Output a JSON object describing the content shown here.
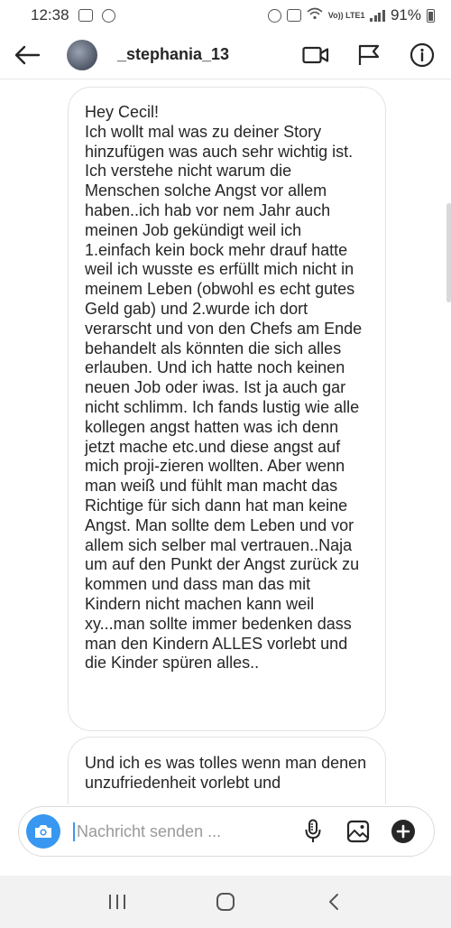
{
  "status_bar": {
    "time": "12:38",
    "network_label": "Vo)) LTE1",
    "battery": "91%"
  },
  "header": {
    "username": "_stephania_13",
    "icons": [
      "back-arrow-icon",
      "video-call-icon",
      "flag-icon",
      "info-icon"
    ]
  },
  "messages": [
    {
      "text": "Hey Cecil!\nIch wollt mal was zu deiner Story hinzufügen was auch sehr wichtig ist. Ich verstehe nicht warum die Menschen solche Angst vor allem haben..ich hab vor nem Jahr auch meinen Job gekündigt weil ich 1.einfach kein bock mehr drauf hatte weil ich wusste es erfüllt mich nicht in meinem Leben (obwohl es echt gutes Geld gab) und 2.wurde ich dort verarscht und von den Chefs am Ende behandelt als könnten die sich alles erlauben. Und ich hatte noch keinen neuen Job oder iwas. Ist ja auch gar nicht schlimm. Ich fands lustig wie alle kollegen angst hatten was ich denn jetzt mache etc.und diese angst auf mich proji-zieren wollten. Aber wenn man weiß und fühlt man macht das Richtige für sich dann hat man keine Angst. Man sollte dem Leben und vor allem sich selber mal vertrauen..Naja um auf den Punkt der Angst zurück zu kommen und dass man das mit Kindern nicht machen kann weil xy...man sollte immer bedenken dass man den Kindern ALLES vorlebt und die Kinder spüren alles.."
    },
    {
      "text": "Und ich es was tolles wenn man denen unzufriedenheit vorlebt und"
    }
  ],
  "composer": {
    "placeholder": "Nachricht senden ...",
    "icons": [
      "camera-icon",
      "microphone-icon",
      "gallery-icon",
      "plus-icon"
    ]
  },
  "navbar": {
    "icons": [
      "recent-apps-icon",
      "home-icon",
      "back-icon"
    ]
  },
  "colors": {
    "accent": "#3897f0",
    "text": "#262626",
    "bubble_border": "#e3e3e3"
  }
}
